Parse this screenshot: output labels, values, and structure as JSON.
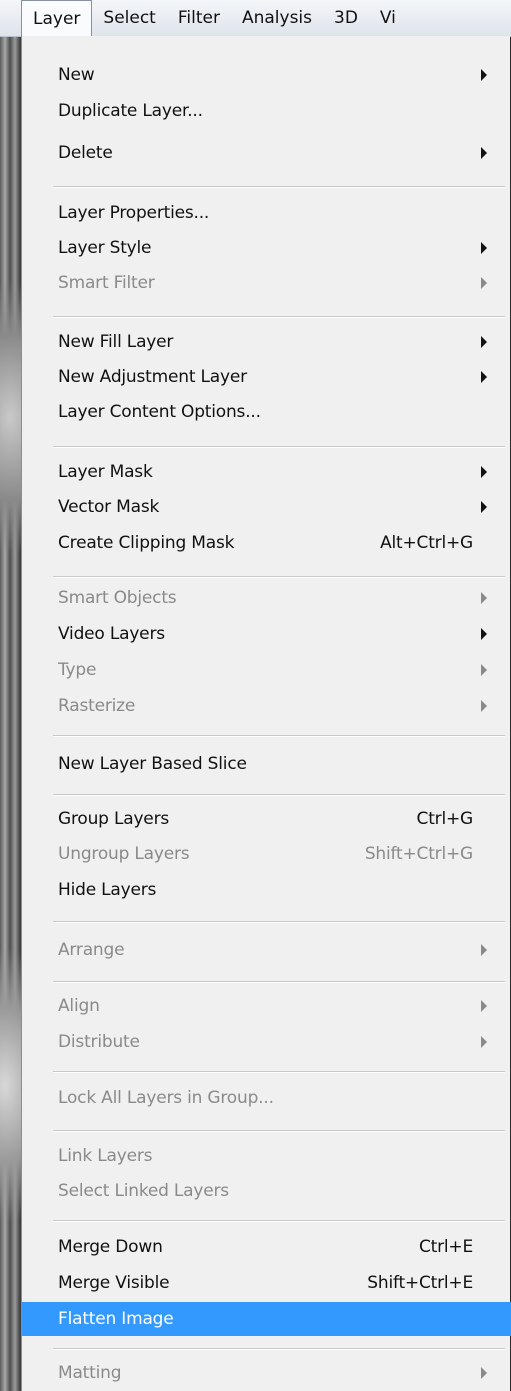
{
  "menubar": {
    "items": [
      "Layer",
      "Select",
      "Filter",
      "Analysis",
      "3D",
      "Vi"
    ]
  },
  "menu": {
    "items": [
      {
        "label": "New",
        "submenu": true
      },
      {
        "label": "Duplicate Layer..."
      },
      {
        "label": "Delete",
        "submenu": true
      },
      {
        "label": "Layer Properties..."
      },
      {
        "label": "Layer Style",
        "submenu": true
      },
      {
        "label": "Smart Filter",
        "submenu": true,
        "disabled": true
      },
      {
        "label": "New Fill Layer",
        "submenu": true
      },
      {
        "label": "New Adjustment Layer",
        "submenu": true
      },
      {
        "label": "Layer Content Options..."
      },
      {
        "label": "Layer Mask",
        "submenu": true
      },
      {
        "label": "Vector Mask",
        "submenu": true
      },
      {
        "label": "Create Clipping Mask",
        "shortcut": "Alt+Ctrl+G"
      },
      {
        "label": "Smart Objects",
        "submenu": true,
        "disabled": true
      },
      {
        "label": "Video Layers",
        "submenu": true
      },
      {
        "label": "Type",
        "submenu": true,
        "disabled": true
      },
      {
        "label": "Rasterize",
        "submenu": true,
        "disabled": true
      },
      {
        "label": "New Layer Based Slice"
      },
      {
        "label": "Group Layers",
        "shortcut": "Ctrl+G"
      },
      {
        "label": "Ungroup Layers",
        "shortcut": "Shift+Ctrl+G",
        "disabled": true
      },
      {
        "label": "Hide Layers"
      },
      {
        "label": "Arrange",
        "submenu": true,
        "disabled": true
      },
      {
        "label": "Align",
        "submenu": true,
        "disabled": true
      },
      {
        "label": "Distribute",
        "submenu": true,
        "disabled": true
      },
      {
        "label": "Lock All Layers in Group...",
        "disabled": true
      },
      {
        "label": "Link Layers",
        "disabled": true
      },
      {
        "label": "Select Linked Layers",
        "disabled": true
      },
      {
        "label": "Merge Down",
        "shortcut": "Ctrl+E"
      },
      {
        "label": "Merge Visible",
        "shortcut": "Shift+Ctrl+E"
      },
      {
        "label": "Flatten Image",
        "highlighted": true
      },
      {
        "label": "Matting",
        "submenu": true,
        "disabled": true
      }
    ]
  }
}
